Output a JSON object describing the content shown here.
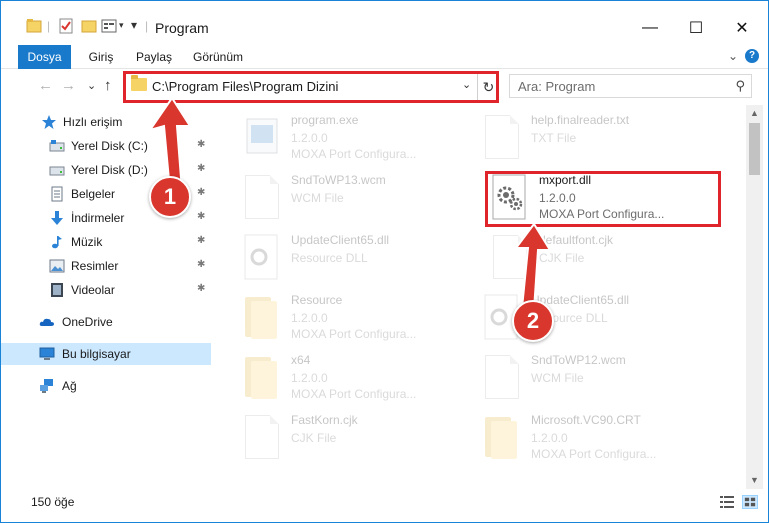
{
  "window": {
    "title": "Program",
    "controls": {
      "minimize": "—",
      "maximize": "☐",
      "close": "✕"
    }
  },
  "ribbon": {
    "tabs": [
      {
        "label": "Dosya",
        "active": true
      },
      {
        "label": "Giriş",
        "active": false
      },
      {
        "label": "Paylaş",
        "active": false
      },
      {
        "label": "Görünüm",
        "active": false
      }
    ],
    "expand_glyph": "⌄",
    "help_glyph": "?"
  },
  "nav": {
    "back": "←",
    "forward": "→",
    "recent": "⌄",
    "up": "↑",
    "address": "C:\\Program Files\\Program Dizini",
    "address_chevron": "⌄",
    "refresh": "↻",
    "search_placeholder": "Ara: Program",
    "search_glyph": "⚲"
  },
  "sidebar": {
    "items": [
      {
        "label": "Hızlı erişim",
        "icon": "star-icon",
        "pinned": false
      },
      {
        "label": "Yerel Disk (C:)",
        "icon": "drive-icon",
        "pinned": true
      },
      {
        "label": "Yerel Disk (D:)",
        "icon": "drive-icon",
        "pinned": true
      },
      {
        "label": "Belgeler",
        "icon": "documents-icon",
        "pinned": true
      },
      {
        "label": "İndirmeler",
        "icon": "download-icon",
        "pinned": true
      },
      {
        "label": "Müzik",
        "icon": "music-icon",
        "pinned": true
      },
      {
        "label": "Resimler",
        "icon": "pictures-icon",
        "pinned": true
      },
      {
        "label": "Videolar",
        "icon": "videos-icon",
        "pinned": true
      },
      {
        "label": "OneDrive",
        "icon": "cloud-icon",
        "pinned": false
      },
      {
        "label": "Bu bilgisayar",
        "icon": "computer-icon",
        "pinned": false,
        "selected": true
      },
      {
        "label": "Ağ",
        "icon": "network-icon",
        "pinned": false
      }
    ],
    "pin_glyph": "📌"
  },
  "files": [
    {
      "name": "program.exe",
      "line2": "1.2.0.0",
      "line3": "MOXA Port Configura...",
      "icon": "exe-icon",
      "faded": true
    },
    {
      "name": "help.finalreader.txt",
      "line2": "TXT File",
      "line3": "",
      "icon": "document-icon",
      "faded": true
    },
    {
      "name": "SndToWP13.wcm",
      "line2": "WCM File",
      "line3": "",
      "icon": "document-icon",
      "faded": true
    },
    {
      "name": "mxport.dll",
      "line2": "1.2.0.0",
      "line3": "MOXA Port Configura...",
      "icon": "dll-icon",
      "faded": false
    },
    {
      "name": "UpdateClient65.dll",
      "line2": "Resource DLL",
      "line3": "",
      "icon": "dll-icon",
      "faded": true
    },
    {
      "name": "defaultfont.cjk",
      "line2": "CJK File",
      "line3": "",
      "icon": "document-icon",
      "faded": true
    },
    {
      "name": "Resource",
      "line2": "1.2.0.0",
      "line3": "MOXA Port Configura...",
      "icon": "folder-icon",
      "faded": true
    },
    {
      "name": "UpdateClient65.dll",
      "line2": "Resource DLL",
      "line3": "",
      "icon": "dll-icon",
      "faded": true
    },
    {
      "name": "x64",
      "line2": "1.2.0.0",
      "line3": "MOXA Port Configura...",
      "icon": "folder-icon",
      "faded": true
    },
    {
      "name": "SndToWP12.wcm",
      "line2": "WCM File",
      "line3": "",
      "icon": "document-icon",
      "faded": true
    },
    {
      "name": "FastKorn.cjk",
      "line2": "CJK File",
      "line3": "",
      "icon": "document-icon",
      "faded": true
    },
    {
      "name": "Microsoft.VC90.CRT",
      "line2": "1.2.0.0",
      "line3": "MOXA Port Configura...",
      "icon": "folder-icon",
      "faded": true
    }
  ],
  "status": {
    "count": "150 öğe"
  },
  "annotations": {
    "step1": "1",
    "step2": "2",
    "color": "#d9362d"
  },
  "colors": {
    "accent": "#1979ca",
    "selection": "#cce8ff",
    "highlight_border": "#e0242b"
  }
}
